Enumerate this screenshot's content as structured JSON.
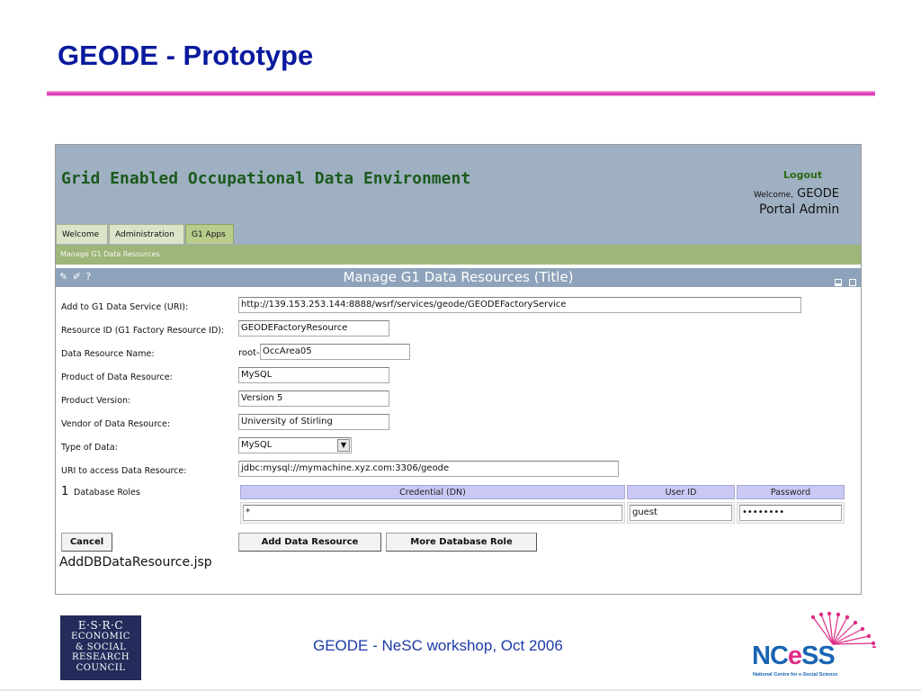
{
  "slide": {
    "title": "GEODE - Prototype",
    "footer": "GEODE -  NeSC workshop, Oct 2006"
  },
  "portal": {
    "name": "Grid Enabled Occupational Data Environment",
    "logout": "Logout",
    "welcome_prefix": "Welcome,",
    "user_name": "GEODE",
    "user_role": "Portal Admin",
    "tabs": [
      {
        "label": "Welcome"
      },
      {
        "label": "Administration"
      },
      {
        "label": "G1 Apps",
        "active": true
      }
    ],
    "breadcrumb": "Manage G1 Data Resources",
    "panel_title": "Manage G1 Data Resources (Title)",
    "panel_icons": "✎ ✐ ?"
  },
  "form": {
    "service_uri": {
      "label": "Add to G1 Data Service (URI):",
      "value": "http://139.153.253.144:8888/wsrf/services/geode/GEODEFactoryService"
    },
    "resource_id": {
      "label": "Resource ID (G1 Factory Resource ID):",
      "value": "GEODEFactoryResource"
    },
    "resource_name": {
      "label": "Data Resource Name:",
      "prefix": "root-",
      "value": "OccArea05"
    },
    "product": {
      "label": "Product of Data Resource:",
      "value": "MySQL"
    },
    "version": {
      "label": "Product Version:",
      "value": "Version 5"
    },
    "vendor": {
      "label": "Vendor of Data Resource:",
      "value": "University of Stirling"
    },
    "data_type": {
      "label": "Type of Data:",
      "value": "MySQL"
    },
    "access_uri": {
      "label": "URI to access Data Resource:",
      "value": "jdbc:mysql://mymachine.xyz.com:3306/geode"
    },
    "roles": {
      "count": "1",
      "label": "Database Roles",
      "columns": [
        "Credential (DN)",
        "User ID",
        "Password"
      ],
      "row": {
        "credential": "*",
        "user_id": "guest",
        "password": "••••••••"
      }
    }
  },
  "buttons": {
    "cancel": "Cancel",
    "add": "Add Data Resource",
    "more": "More Database Role"
  },
  "jsp": "AddDBDataResource.jsp",
  "logos": {
    "esrc": [
      "E·S·R·C",
      "ECONOMIC",
      "& SOCIAL",
      "RESEARCH",
      "COUNCIL"
    ],
    "ncess_prefix": "NC",
    "ncess_e": "e",
    "ncess_suffix": "SS",
    "ncess_tag": "National Centre for e-Social Science"
  },
  "colors": {
    "title": "#0a1a9e",
    "rule": "#d41ea4",
    "header_bg": "#9fb0c2",
    "portal_name": "#1c5a1c",
    "ncess_blue": "#1a64b2",
    "ncess_pink": "#e02d86"
  }
}
